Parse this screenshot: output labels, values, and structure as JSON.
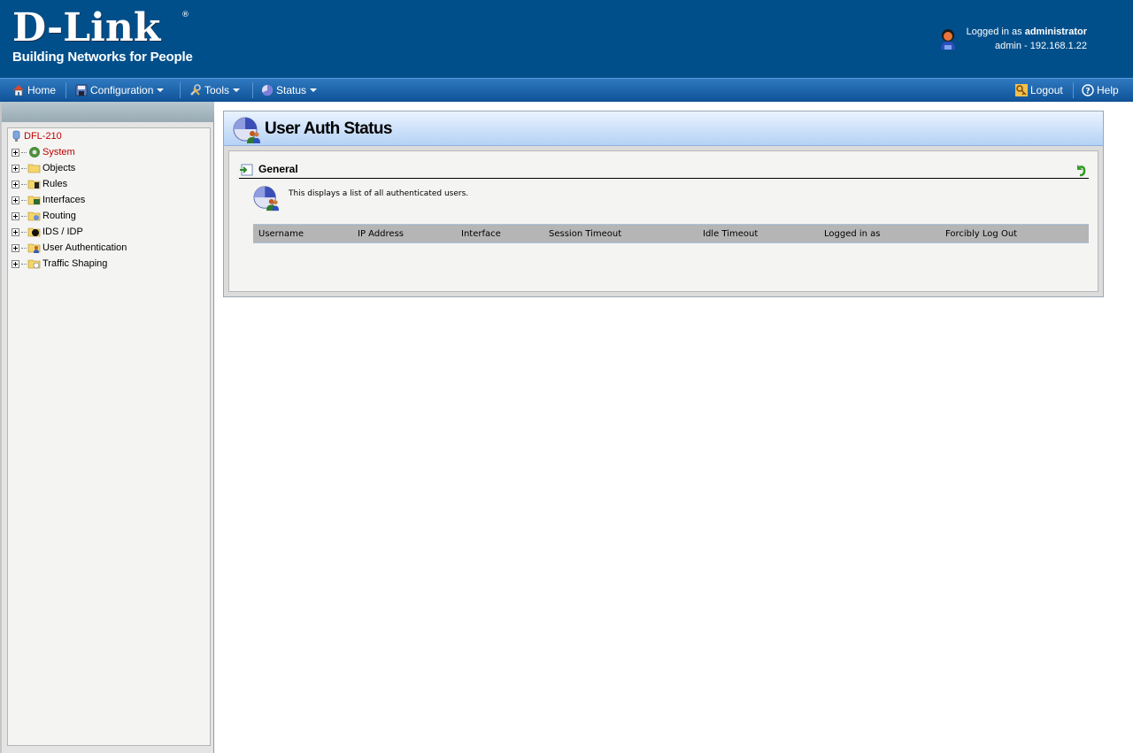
{
  "header": {
    "brand": "D-Link",
    "registered_mark": "®",
    "tagline": "Building Networks for People",
    "logged_in_prefix": "Logged in as",
    "logged_in_user": "administrator",
    "session_info": "admin - 192.168.1.22"
  },
  "menubar": {
    "home": "Home",
    "configuration": "Configuration",
    "tools": "Tools",
    "status": "Status",
    "logout": "Logout",
    "help": "Help"
  },
  "tree": {
    "root": "DFL-210",
    "items": [
      {
        "label": "System",
        "icon": "gear-icon",
        "selected": true
      },
      {
        "label": "Objects",
        "icon": "folder-icon",
        "selected": false
      },
      {
        "label": "Rules",
        "icon": "rules-icon",
        "selected": false
      },
      {
        "label": "Interfaces",
        "icon": "interfaces-icon",
        "selected": false
      },
      {
        "label": "Routing",
        "icon": "routing-icon",
        "selected": false
      },
      {
        "label": "IDS / IDP",
        "icon": "ids-icon",
        "selected": false
      },
      {
        "label": "User Authentication",
        "icon": "user-auth-icon",
        "selected": false
      },
      {
        "label": "Traffic Shaping",
        "icon": "traffic-shaping-icon",
        "selected": false
      }
    ]
  },
  "main": {
    "title": "User Auth Status",
    "section_title": "General",
    "description": "This displays a list of all authenticated users.",
    "columns": [
      "Username",
      "IP Address",
      "Interface",
      "Session Timeout",
      "Idle Timeout",
      "Logged in as",
      "Forcibly Log Out"
    ],
    "rows": []
  },
  "colors": {
    "header_bg": "#004f8b",
    "menubar_bg": "#1a63ab",
    "selected_tree_text": "#c00000",
    "title_bar": "#b5d2f5",
    "table_header": "#b5b5b5"
  }
}
